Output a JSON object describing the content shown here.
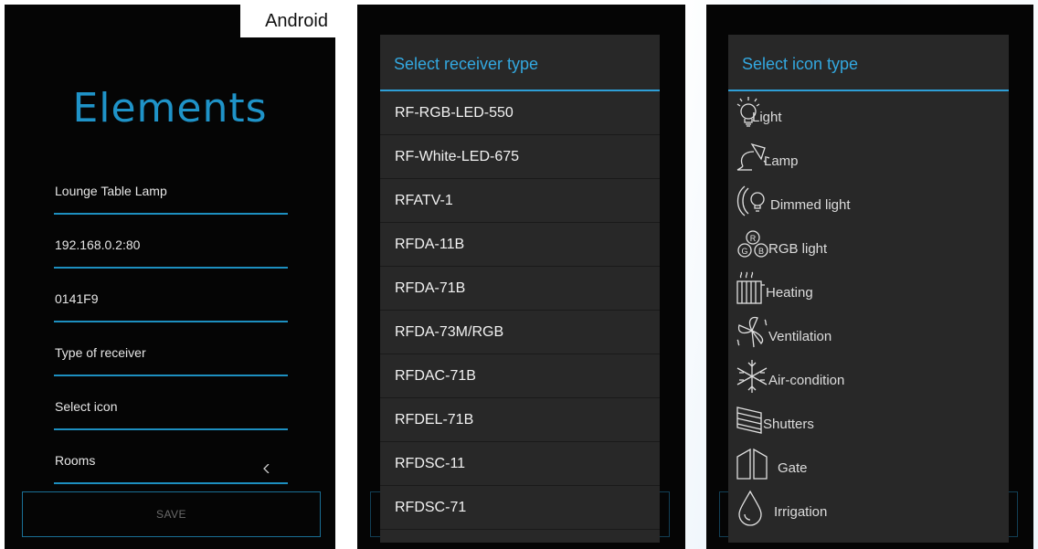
{
  "panel1": {
    "corner_label": "Android",
    "title": "Elements",
    "fields": [
      {
        "label": "Lounge Table Lamp"
      },
      {
        "label": "192.168.0.2:80"
      },
      {
        "label": "0141F9"
      },
      {
        "label": "Type of receiver"
      },
      {
        "label": "Select icon"
      },
      {
        "label": "Rooms"
      }
    ],
    "save_label": "SAVE"
  },
  "receiver_dialog": {
    "title": "Select receiver type",
    "items": [
      "RF-RGB-LED-550",
      "RF-White-LED-675",
      "RFATV-1",
      "RFDA-11B",
      "RFDA-71B",
      "RFDA-73M/RGB",
      "RFDAC-71B",
      "RFDEL-71B",
      "RFDSC-11",
      "RFDSC-71"
    ]
  },
  "icon_dialog": {
    "title": "Select icon type",
    "items": [
      {
        "label": "Light",
        "icon": "bulb-icon"
      },
      {
        "label": "Lamp",
        "icon": "desk-lamp-icon"
      },
      {
        "label": "Dimmed light",
        "icon": "dimmed-bulb-icon"
      },
      {
        "label": "RGB light",
        "icon": "rgb-icon"
      },
      {
        "label": "Heating",
        "icon": "radiator-icon"
      },
      {
        "label": "Ventilation",
        "icon": "fan-icon"
      },
      {
        "label": "Air-condition",
        "icon": "snowflake-icon"
      },
      {
        "label": "Shutters",
        "icon": "shutters-icon"
      },
      {
        "label": "Gate",
        "icon": "gate-icon"
      },
      {
        "label": "Irrigation",
        "icon": "drop-icon"
      }
    ]
  },
  "colors": {
    "accent": "#1f93c8",
    "dialog_bg": "#282828",
    "screen_bg": "#050505"
  }
}
